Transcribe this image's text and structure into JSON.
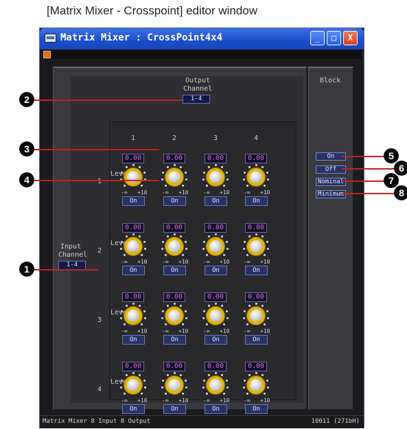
{
  "caption": "[Matrix Mixer - Crosspoint] editor window",
  "window": {
    "title": "Matrix Mixer : CrossPoint4x4",
    "controls": {
      "minimize": "_",
      "maximize": "□",
      "close": "X"
    }
  },
  "output_channel": {
    "label_line1": "Output",
    "label_line2": "Channel",
    "selector": "1-4",
    "columns": [
      "1",
      "2",
      "3",
      "4"
    ]
  },
  "input_channel": {
    "label_line1": "Input",
    "label_line2": "Channel",
    "selector": "1-4",
    "rows": [
      "1",
      "2",
      "3",
      "4"
    ]
  },
  "row_label": "Level",
  "crosspoint": {
    "value": "0.00",
    "scale_min": "-∞",
    "scale_max": "+10",
    "button": "On"
  },
  "block": {
    "title": "Block",
    "buttons": [
      "On",
      "Off",
      "Nominal",
      "Minimum"
    ]
  },
  "status": {
    "left": "Matrix Mixer   8 Input 8 Output",
    "right": "10011 (271bH)"
  },
  "callouts": [
    "1",
    "2",
    "3",
    "4",
    "5",
    "6",
    "7",
    "8"
  ]
}
